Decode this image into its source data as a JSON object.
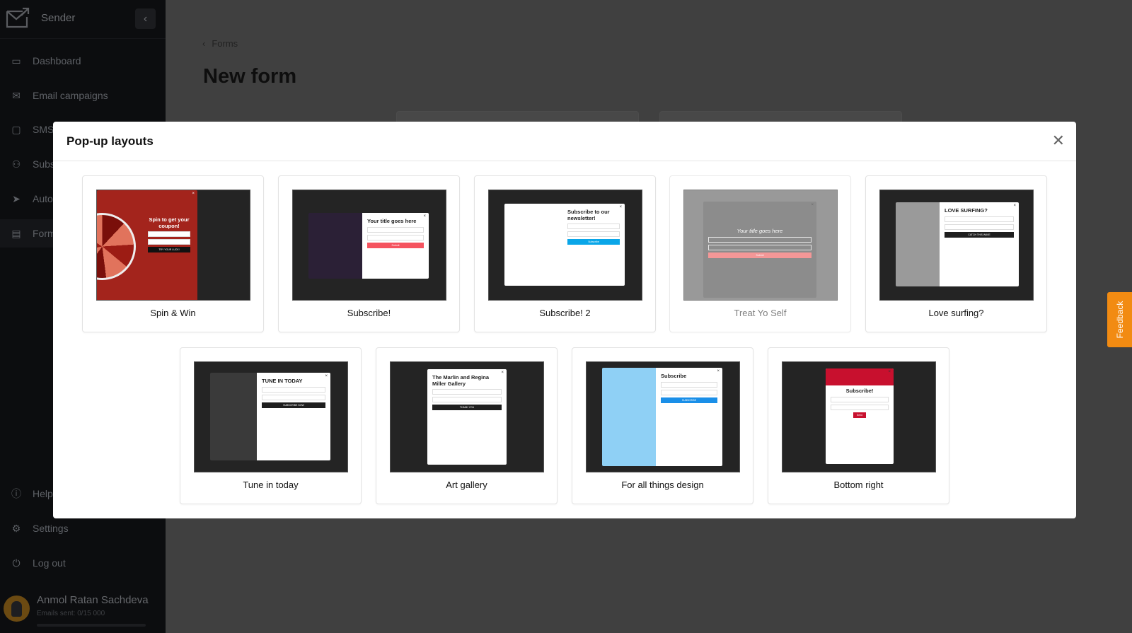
{
  "app": {
    "name": "Sender"
  },
  "sidebar": {
    "items": [
      {
        "label": "Dashboard",
        "icon": "dashboard-icon"
      },
      {
        "label": "Email campaigns",
        "icon": "envelope-icon"
      },
      {
        "label": "SMS",
        "icon": "chat-icon"
      },
      {
        "label": "Subscribers",
        "icon": "users-icon"
      },
      {
        "label": "Automation",
        "icon": "send-icon"
      },
      {
        "label": "Forms",
        "icon": "forms-icon",
        "active": true
      }
    ],
    "bottom": [
      {
        "label": "Help",
        "icon": "info-icon"
      },
      {
        "label": "Settings",
        "icon": "gear-icon"
      },
      {
        "label": "Log out",
        "icon": "power-icon"
      }
    ],
    "user": {
      "name": "Anmol Ratan Sachdeva",
      "emails_sent": "Emails sent: 0/15 000",
      "usage_fraction": 0
    }
  },
  "page": {
    "breadcrumb": "Forms",
    "title": "New form"
  },
  "modal": {
    "title": "Pop-up layouts",
    "layouts": [
      {
        "label": "Spin & Win",
        "popup_title": "Spin to get your coupon!",
        "button": "TRY YOUR LUCK!",
        "accent": "#a3241c"
      },
      {
        "label": "Subscribe!",
        "popup_title": "Your title goes here",
        "button": "Submit",
        "accent": "#f5535f"
      },
      {
        "label": "Subscribe! 2",
        "popup_title": "Subscribe to our newsletter!",
        "button": "Subscribe",
        "accent": "#0aa6e8"
      },
      {
        "label": "Treat Yo Self",
        "popup_title": "Your title goes here",
        "button": "Submit",
        "accent": "#ef7575"
      },
      {
        "label": "Love surfing?",
        "popup_title": "LOVE SURFING?",
        "button": "CATCH THIS WAVE",
        "accent": "#1e1e1e"
      },
      {
        "label": "Tune in today",
        "popup_title": "TUNE IN TODAY",
        "button": "SUBSCRIBE NOW",
        "accent": "#1e1e1e"
      },
      {
        "label": "Art gallery",
        "popup_title": "The Marlin and Regina Miller Gallery",
        "button": "THANK YOU",
        "accent": "#1e1e1e"
      },
      {
        "label": "For all things design",
        "popup_title": "Subscribe",
        "button": "SUBSCRIBE",
        "accent": "#1a8fe8"
      },
      {
        "label": "Bottom right",
        "popup_title": "Subscribe!",
        "button": "Send",
        "accent": "#c8102e"
      }
    ]
  },
  "feedback": {
    "label": "Feedback",
    "color": "#f28b12"
  }
}
